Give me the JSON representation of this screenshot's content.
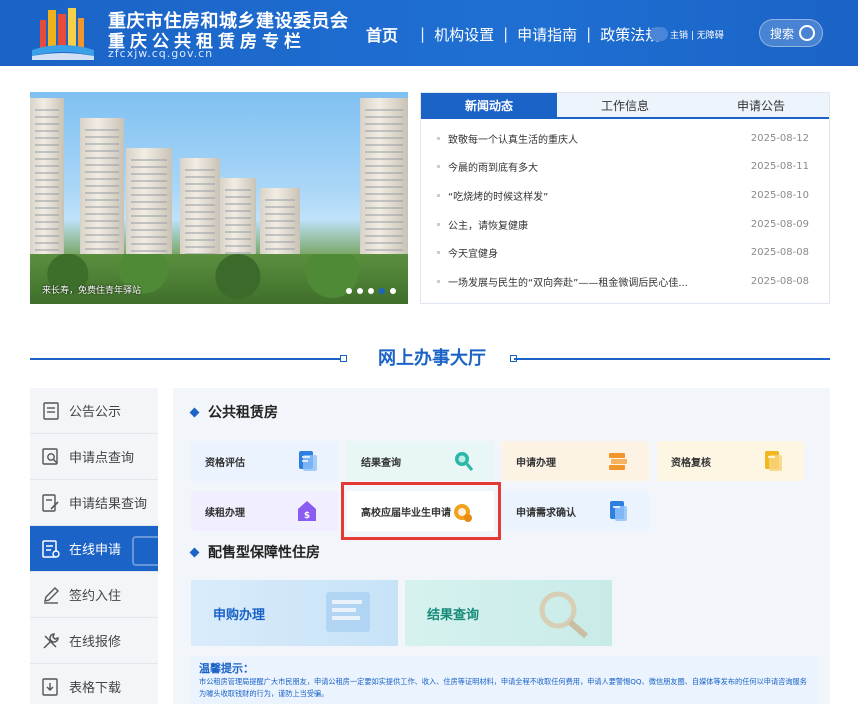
{
  "header": {
    "title_line1": "重庆市住房和城乡建设委员会",
    "title_line2": "重庆公共租赁房专栏",
    "url": "zfcxjw.cq.gov.cn",
    "nav": [
      {
        "label": "首页"
      },
      {
        "label": "机构设置"
      },
      {
        "label": "申请指南"
      },
      {
        "label": "政策法规"
      }
    ],
    "separator": "|",
    "user_links": "主销 | 无障碍",
    "search_label": "搜索"
  },
  "banner": {
    "caption": "来长寿，免费住青年驿站",
    "slide_count": 5,
    "active_slide": 3
  },
  "news": {
    "tabs": [
      "新闻动态",
      "工作信息",
      "申请公告"
    ],
    "active_tab": 0,
    "items": [
      {
        "title": "致敬每一个认真生活的重庆人",
        "date": "2025-08-12"
      },
      {
        "title": "今晨的雨到底有多大",
        "date": "2025-08-11"
      },
      {
        "title": "“吃烧烤的时候这样发”",
        "date": "2025-08-10"
      },
      {
        "title": "公主，请恢复健康",
        "date": "2025-08-09"
      },
      {
        "title": "今天宜健身",
        "date": "2025-08-08"
      },
      {
        "title": "一场发展与民生的“双向奔赴”——租金微调后民心佳...",
        "date": "2025-08-08"
      }
    ]
  },
  "section": {
    "title": "网上办事大厅"
  },
  "sidebar": {
    "items": [
      {
        "label": "公告公示",
        "icon": "document-icon"
      },
      {
        "label": "申请点查询",
        "icon": "search-doc-icon"
      },
      {
        "label": "申请结果查询",
        "icon": "edit-doc-icon"
      },
      {
        "label": "在线申请",
        "icon": "apply-icon"
      },
      {
        "label": "签约入住",
        "icon": "pen-icon"
      },
      {
        "label": "在线报修",
        "icon": "wrench-icon"
      },
      {
        "label": "表格下载",
        "icon": "download-icon"
      }
    ],
    "active_index": 3
  },
  "public_rental": {
    "title": "公共租赁房",
    "cards": [
      {
        "label": "资格评估",
        "color": "#2f7fe0"
      },
      {
        "label": "结果查询",
        "color": "#2bb6a8"
      },
      {
        "label": "申请办理",
        "color": "#f0962c"
      },
      {
        "label": "资格复核",
        "color": "#f2b61f"
      },
      {
        "label": "续租办理",
        "color": "#8a5cf0"
      },
      {
        "label": "高校应届毕业生申请",
        "color": "#f0a21c"
      },
      {
        "label": "申请需求确认",
        "color": "#2f7fe0"
      }
    ]
  },
  "sale_housing": {
    "title": "配售型保障性住房",
    "cards": [
      {
        "label": "申购办理"
      },
      {
        "label": "结果查询"
      }
    ]
  },
  "tips": {
    "heading": "温馨提示：",
    "body": "市公租房管理局提醒广大市民朋友，申请公租房一定要如实提供工作、收入、住房等证明材料，申请全程不收取任何费用，申请人要警惕QQ、微信朋友圈、自媒体等发布的任何以申请咨询服务为噱头收取钱财的行为，谨防上当受骗。"
  }
}
